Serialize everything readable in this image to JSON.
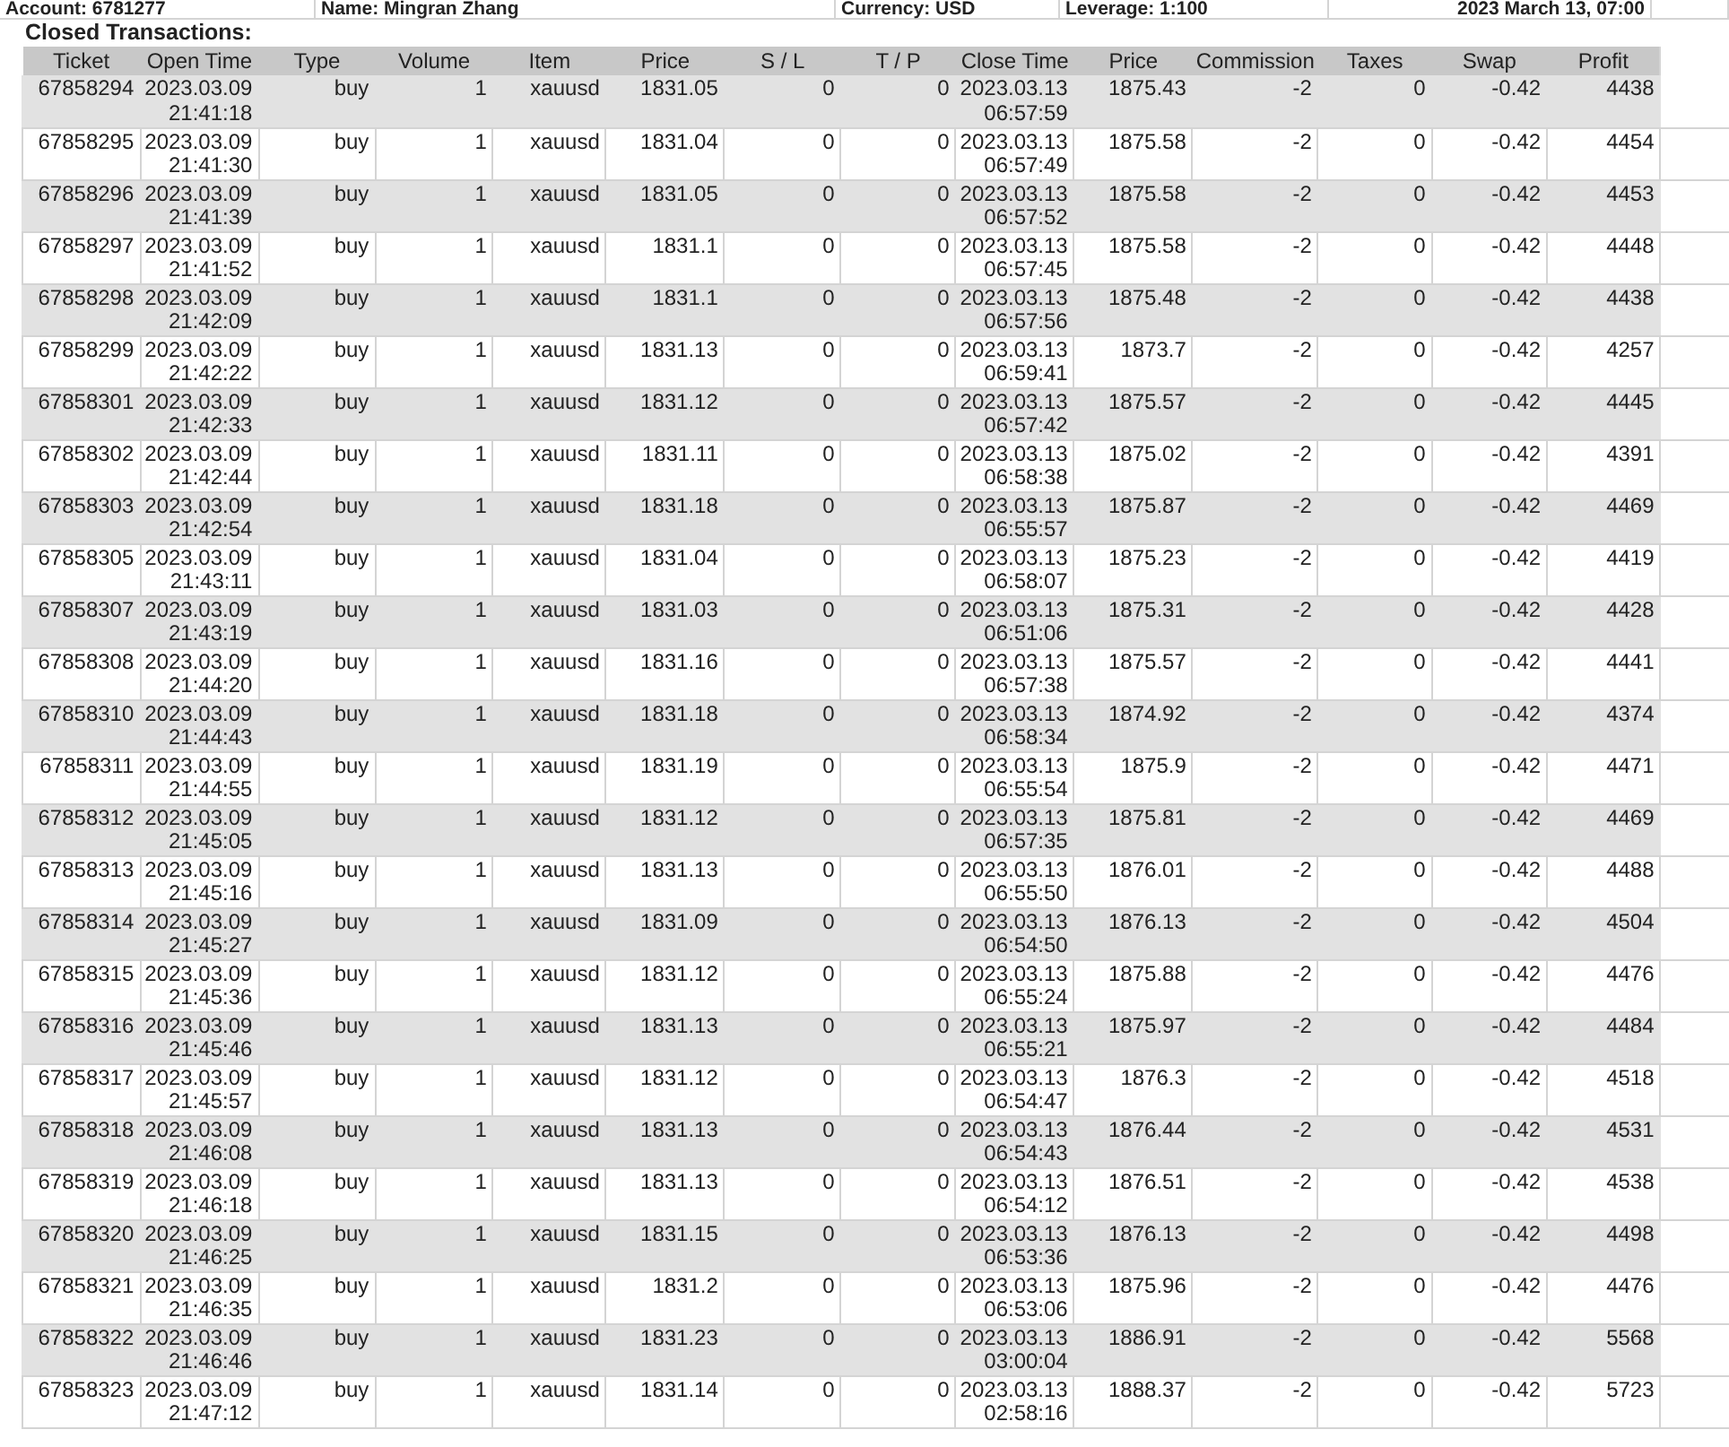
{
  "account_info": [
    "Account: 6781277",
    "Name: Mingran Zhang",
    "Currency: USD",
    "Leverage: 1:100",
    "2023 March 13, 07:00"
  ],
  "section_title": "Closed Transactions:",
  "table": {
    "columns": [
      "Ticket",
      "Open Time",
      "Type",
      "Volume",
      "Item",
      "Price",
      "S / L",
      "T / P",
      "Close Time",
      "Price",
      "Commission",
      "Taxes",
      "Swap",
      "Profit"
    ],
    "rows": [
      [
        "67858294",
        "2023.03.09 21:41:18",
        "buy",
        "1",
        "xauusd",
        "1831.05",
        "0",
        "0",
        "2023.03.13 06:57:59",
        "1875.43",
        "-2",
        "0",
        "-0.42",
        "4438"
      ],
      [
        "67858295",
        "2023.03.09 21:41:30",
        "buy",
        "1",
        "xauusd",
        "1831.04",
        "0",
        "0",
        "2023.03.13 06:57:49",
        "1875.58",
        "-2",
        "0",
        "-0.42",
        "4454"
      ],
      [
        "67858296",
        "2023.03.09 21:41:39",
        "buy",
        "1",
        "xauusd",
        "1831.05",
        "0",
        "0",
        "2023.03.13 06:57:52",
        "1875.58",
        "-2",
        "0",
        "-0.42",
        "4453"
      ],
      [
        "67858297",
        "2023.03.09 21:41:52",
        "buy",
        "1",
        "xauusd",
        "1831.1",
        "0",
        "0",
        "2023.03.13 06:57:45",
        "1875.58",
        "-2",
        "0",
        "-0.42",
        "4448"
      ],
      [
        "67858298",
        "2023.03.09 21:42:09",
        "buy",
        "1",
        "xauusd",
        "1831.1",
        "0",
        "0",
        "2023.03.13 06:57:56",
        "1875.48",
        "-2",
        "0",
        "-0.42",
        "4438"
      ],
      [
        "67858299",
        "2023.03.09 21:42:22",
        "buy",
        "1",
        "xauusd",
        "1831.13",
        "0",
        "0",
        "2023.03.13 06:59:41",
        "1873.7",
        "-2",
        "0",
        "-0.42",
        "4257"
      ],
      [
        "67858301",
        "2023.03.09 21:42:33",
        "buy",
        "1",
        "xauusd",
        "1831.12",
        "0",
        "0",
        "2023.03.13 06:57:42",
        "1875.57",
        "-2",
        "0",
        "-0.42",
        "4445"
      ],
      [
        "67858302",
        "2023.03.09 21:42:44",
        "buy",
        "1",
        "xauusd",
        "1831.11",
        "0",
        "0",
        "2023.03.13 06:58:38",
        "1875.02",
        "-2",
        "0",
        "-0.42",
        "4391"
      ],
      [
        "67858303",
        "2023.03.09 21:42:54",
        "buy",
        "1",
        "xauusd",
        "1831.18",
        "0",
        "0",
        "2023.03.13 06:55:57",
        "1875.87",
        "-2",
        "0",
        "-0.42",
        "4469"
      ],
      [
        "67858305",
        "2023.03.09 21:43:11",
        "buy",
        "1",
        "xauusd",
        "1831.04",
        "0",
        "0",
        "2023.03.13 06:58:07",
        "1875.23",
        "-2",
        "0",
        "-0.42",
        "4419"
      ],
      [
        "67858307",
        "2023.03.09 21:43:19",
        "buy",
        "1",
        "xauusd",
        "1831.03",
        "0",
        "0",
        "2023.03.13 06:51:06",
        "1875.31",
        "-2",
        "0",
        "-0.42",
        "4428"
      ],
      [
        "67858308",
        "2023.03.09 21:44:20",
        "buy",
        "1",
        "xauusd",
        "1831.16",
        "0",
        "0",
        "2023.03.13 06:57:38",
        "1875.57",
        "-2",
        "0",
        "-0.42",
        "4441"
      ],
      [
        "67858310",
        "2023.03.09 21:44:43",
        "buy",
        "1",
        "xauusd",
        "1831.18",
        "0",
        "0",
        "2023.03.13 06:58:34",
        "1874.92",
        "-2",
        "0",
        "-0.42",
        "4374"
      ],
      [
        "67858311",
        "2023.03.09 21:44:55",
        "buy",
        "1",
        "xauusd",
        "1831.19",
        "0",
        "0",
        "2023.03.13 06:55:54",
        "1875.9",
        "-2",
        "0",
        "-0.42",
        "4471"
      ],
      [
        "67858312",
        "2023.03.09 21:45:05",
        "buy",
        "1",
        "xauusd",
        "1831.12",
        "0",
        "0",
        "2023.03.13 06:57:35",
        "1875.81",
        "-2",
        "0",
        "-0.42",
        "4469"
      ],
      [
        "67858313",
        "2023.03.09 21:45:16",
        "buy",
        "1",
        "xauusd",
        "1831.13",
        "0",
        "0",
        "2023.03.13 06:55:50",
        "1876.01",
        "-2",
        "0",
        "-0.42",
        "4488"
      ],
      [
        "67858314",
        "2023.03.09 21:45:27",
        "buy",
        "1",
        "xauusd",
        "1831.09",
        "0",
        "0",
        "2023.03.13 06:54:50",
        "1876.13",
        "-2",
        "0",
        "-0.42",
        "4504"
      ],
      [
        "67858315",
        "2023.03.09 21:45:36",
        "buy",
        "1",
        "xauusd",
        "1831.12",
        "0",
        "0",
        "2023.03.13 06:55:24",
        "1875.88",
        "-2",
        "0",
        "-0.42",
        "4476"
      ],
      [
        "67858316",
        "2023.03.09 21:45:46",
        "buy",
        "1",
        "xauusd",
        "1831.13",
        "0",
        "0",
        "2023.03.13 06:55:21",
        "1875.97",
        "-2",
        "0",
        "-0.42",
        "4484"
      ],
      [
        "67858317",
        "2023.03.09 21:45:57",
        "buy",
        "1",
        "xauusd",
        "1831.12",
        "0",
        "0",
        "2023.03.13 06:54:47",
        "1876.3",
        "-2",
        "0",
        "-0.42",
        "4518"
      ],
      [
        "67858318",
        "2023.03.09 21:46:08",
        "buy",
        "1",
        "xauusd",
        "1831.13",
        "0",
        "0",
        "2023.03.13 06:54:43",
        "1876.44",
        "-2",
        "0",
        "-0.42",
        "4531"
      ],
      [
        "67858319",
        "2023.03.09 21:46:18",
        "buy",
        "1",
        "xauusd",
        "1831.13",
        "0",
        "0",
        "2023.03.13 06:54:12",
        "1876.51",
        "-2",
        "0",
        "-0.42",
        "4538"
      ],
      [
        "67858320",
        "2023.03.09 21:46:25",
        "buy",
        "1",
        "xauusd",
        "1831.15",
        "0",
        "0",
        "2023.03.13 06:53:36",
        "1876.13",
        "-2",
        "0",
        "-0.42",
        "4498"
      ],
      [
        "67858321",
        "2023.03.09 21:46:35",
        "buy",
        "1",
        "xauusd",
        "1831.2",
        "0",
        "0",
        "2023.03.13 06:53:06",
        "1875.96",
        "-2",
        "0",
        "-0.42",
        "4476"
      ],
      [
        "67858322",
        "2023.03.09 21:46:46",
        "buy",
        "1",
        "xauusd",
        "1831.23",
        "0",
        "0",
        "2023.03.13 03:00:04",
        "1886.91",
        "-2",
        "0",
        "-0.42",
        "5568"
      ],
      [
        "67858323",
        "2023.03.09 21:47:12",
        "buy",
        "1",
        "xauusd",
        "1831.14",
        "0",
        "0",
        "2023.03.13 02:58:16",
        "1888.37",
        "-2",
        "0",
        "-0.42",
        "5723"
      ]
    ]
  }
}
